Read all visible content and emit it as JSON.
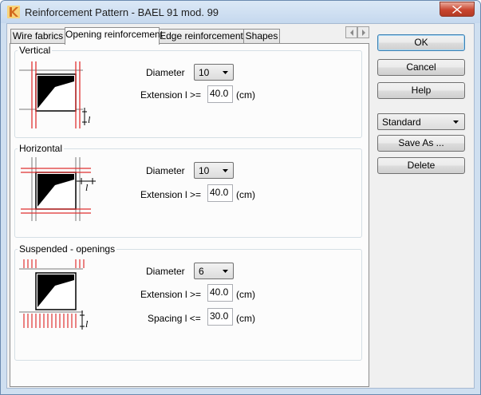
{
  "window": {
    "title": "Reinforcement Pattern - BAEL 91 mod. 99",
    "app_icon": "robot-logo-icon",
    "close_icon": "close-icon"
  },
  "tabs": [
    {
      "label": "Wire fabrics",
      "active": false
    },
    {
      "label": "Opening reinforcement",
      "active": true
    },
    {
      "label": "Edge reinforcement",
      "active": false
    },
    {
      "label": "Shapes",
      "active": false
    }
  ],
  "tab_scroll": {
    "left_icon": "chevron-left-icon",
    "right_icon": "chevron-right-icon"
  },
  "vertical": {
    "title": "Vertical",
    "diameter_label": "Diameter",
    "diameter_value": "10",
    "extension_label": "Extension l >=",
    "extension_value": "40.0",
    "unit": "(cm)",
    "dimension_glyph": "l"
  },
  "horizontal": {
    "title": "Horizontal",
    "diameter_label": "Diameter",
    "diameter_value": "10",
    "extension_label": "Extension l >=",
    "extension_value": "40.0",
    "unit": "(cm)",
    "dimension_glyph": "l"
  },
  "suspended": {
    "title": "Suspended - openings",
    "diameter_label": "Diameter",
    "diameter_value": "6",
    "extension_label": "Extension l >=",
    "extension_value": "40.0",
    "extension_unit": "(cm)",
    "spacing_label": "Spacing l <=",
    "spacing_value": "30.0",
    "spacing_unit": "(cm)",
    "dimension_glyph": "l"
  },
  "side": {
    "ok": "OK",
    "cancel": "Cancel",
    "help": "Help",
    "preset_value": "Standard",
    "save_as": "Save As ...",
    "delete": "Delete"
  },
  "colors": {
    "rebar": "#e03030",
    "grid": "#7a7a7a",
    "fill": "#000000",
    "title_bar": "#cfdff0"
  }
}
